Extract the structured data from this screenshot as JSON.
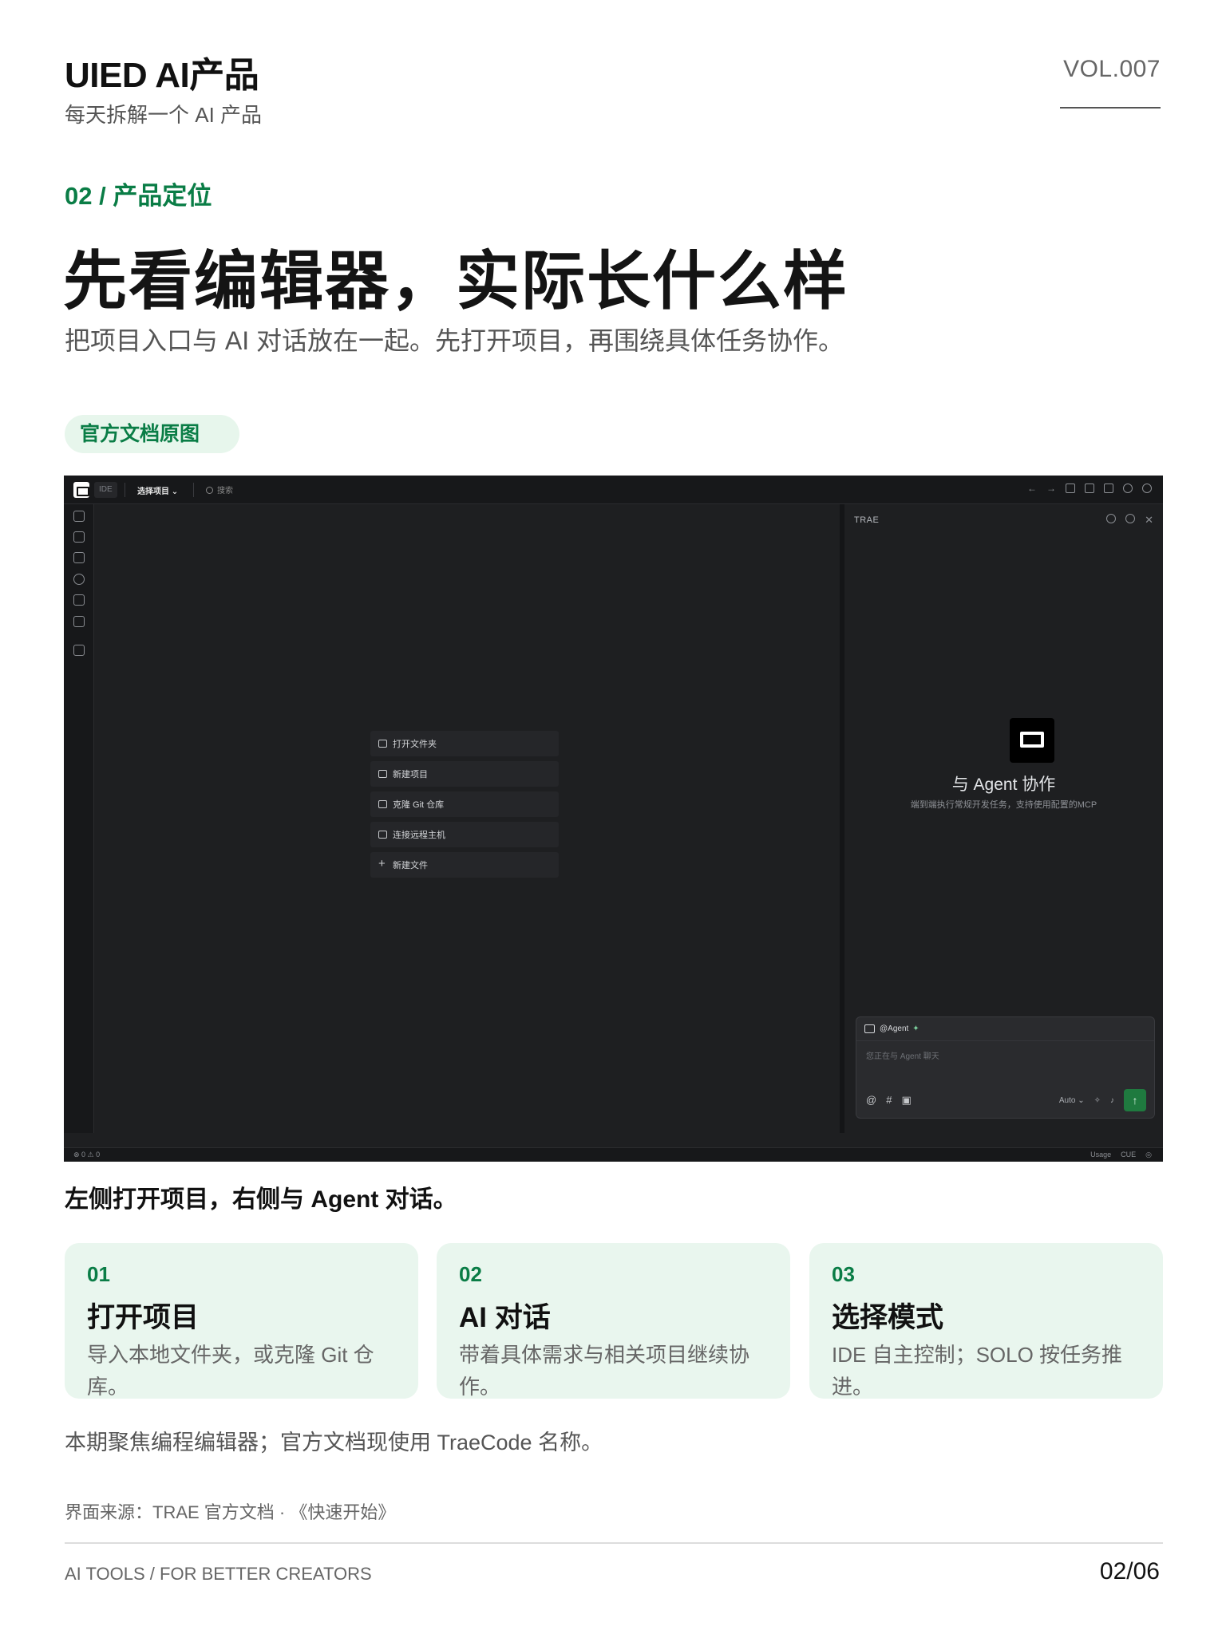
{
  "header": {
    "brand": "UIED AI产品",
    "brand_sub": "每天拆解一个 AI 产品",
    "volume": "VOL.007"
  },
  "section": {
    "label": "02 / 产品定位",
    "headline": "先看编辑器，实际长什么样",
    "subline": "把项目入口与 AI 对话放在一起。先打开项目，再围绕具体任务协作。",
    "tag": "官方文档原图"
  },
  "ide": {
    "mode": "IDE",
    "project_select": "选择项目 ⌄",
    "search": "搜索",
    "welcome_items": [
      "打开文件夹",
      "新建项目",
      "克隆 Git 仓库",
      "连接远程主机",
      "新建文件"
    ],
    "panel_title": "TRAE",
    "agent_title": "与 Agent 协作",
    "agent_desc": "端到端执行常规开发任务，支持使用配置的MCP",
    "chat_agent": "@Agent",
    "chat_placeholder": "您正在与 Agent 聊天",
    "chat_model": "Auto ⌄",
    "status_left": "⊗ 0 ⚠ 0",
    "status_usage": "Usage",
    "status_cue": "CUE",
    "icons": [
      "files-icon",
      "search-icon",
      "source-control-icon",
      "preview-icon",
      "debug-icon",
      "remote-icon",
      "extensions-icon"
    ]
  },
  "caption": "左侧打开项目，右侧与 Agent 对话。",
  "cards": [
    {
      "num": "01",
      "title": "打开项目",
      "desc": "导入本地文件夹，或克隆 Git 仓库。"
    },
    {
      "num": "02",
      "title": "AI 对话",
      "desc": "带着具体需求与相关项目继续协作。"
    },
    {
      "num": "03",
      "title": "选择模式",
      "desc": "IDE 自主控制；SOLO 按任务推进。"
    }
  ],
  "note": "本期聚焦编程编辑器；官方文档现使用 TraeCode 名称。",
  "source": "界面来源：TRAE 官方文档 · 《快速开始》",
  "footer": {
    "left": "AI TOOLS / FOR BETTER CREATORS",
    "page": "02/06"
  },
  "colors": {
    "accent": "#0a7d46",
    "card_bg": "#e9f6ee",
    "ide_bg": "#1e1f21"
  }
}
